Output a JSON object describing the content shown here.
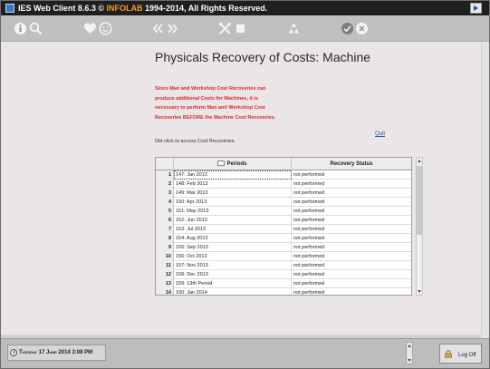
{
  "window": {
    "title": "IES Web Client 8.6.3 © ",
    "brand": "INFOLAB",
    "title_suffix": " 1994-2014, All Rights Reserved."
  },
  "toolbar": {
    "icons": [
      "info-icon",
      "search-icon",
      "heart-icon",
      "smiley-icon",
      "back-icon",
      "forward-icon",
      "tools-icon",
      "stop-icon",
      "recycle-icon",
      "check-icon",
      "cancel-icon"
    ]
  },
  "page": {
    "title": "Physicals Recovery of Costs: Machine",
    "warning": "Since Man and Workshop Cost Recoveries can produce additional Costs for Machines, it is necessary to perform Man and Workshop Cost Recoveries BEFORE the Machine Cost Recoveries.",
    "quit_label": "Quit",
    "hint": "Dbl-click to access Cost Recoveries."
  },
  "grid": {
    "columns": [
      "Periods",
      "Recovery Status"
    ],
    "rows": [
      {
        "n": "1",
        "period": "147: Jan 2013",
        "status": "not performed"
      },
      {
        "n": "2",
        "period": "148: Feb 2013",
        "status": "not performed"
      },
      {
        "n": "3",
        "period": "149: Mar 2013",
        "status": "not performed"
      },
      {
        "n": "4",
        "period": "150: Apr 2013",
        "status": "not performed"
      },
      {
        "n": "5",
        "period": "151: May 2013",
        "status": "not performed"
      },
      {
        "n": "6",
        "period": "152: Jun 2013",
        "status": "not performed"
      },
      {
        "n": "7",
        "period": "153: Jul 2013",
        "status": "not performed"
      },
      {
        "n": "8",
        "period": "154: Aug 2013",
        "status": "not performed"
      },
      {
        "n": "9",
        "period": "155: Sep 2013",
        "status": "not performed"
      },
      {
        "n": "10",
        "period": "156: Oct 2013",
        "status": "not performed"
      },
      {
        "n": "11",
        "period": "157: Nov 2013",
        "status": "not performed"
      },
      {
        "n": "12",
        "period": "158: Dec 2013",
        "status": "not performed"
      },
      {
        "n": "13",
        "period": "159: 13th Period",
        "status": "not performed"
      },
      {
        "n": "14",
        "period": "160: Jan 2014",
        "status": "not performed"
      }
    ]
  },
  "status": {
    "datetime": "Tuesday 17 June 2014 3:08 PM",
    "logoff_label": "Log Off"
  },
  "colors": {
    "warning": "#e0252b",
    "brand": "#f2a020",
    "link": "#2f4fa8"
  }
}
